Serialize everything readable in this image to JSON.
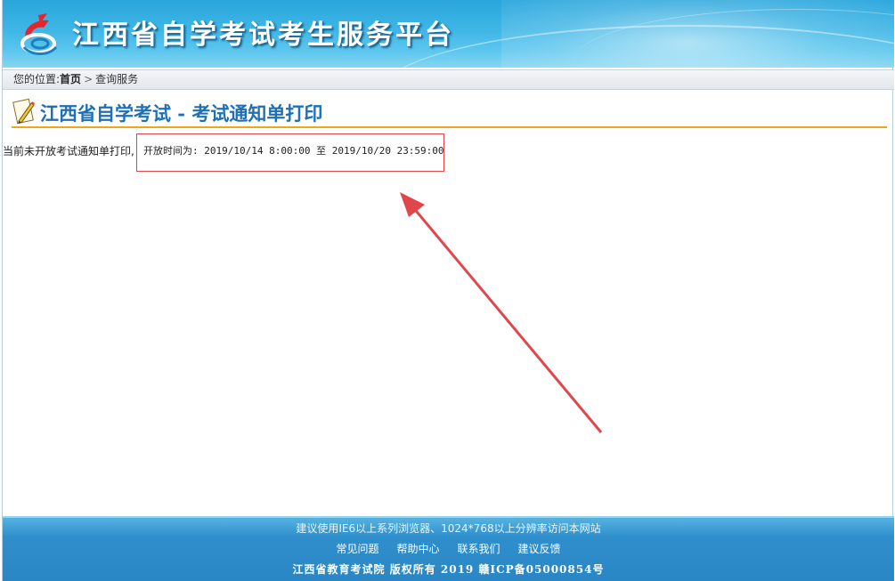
{
  "header": {
    "site_title": "江西省自学考试考生服务平台",
    "logo_icon": "red-blue-swirl-logo-icon",
    "brand_color": "#2aa6dc"
  },
  "breadcrumb": {
    "prefix": "您的位置:",
    "home": "首页",
    "separator": ">",
    "current": "查询服务"
  },
  "page": {
    "heading_icon": "pencil-icon",
    "title": "江西省自学考试 - 考试通知单打印",
    "title_color": "#1f6fb4",
    "underline_color": "#f0a51e"
  },
  "notice": {
    "message": "当前未开放考试通知单打印,",
    "open_time_label": "开放时间为:",
    "start": "2019/10/14 8:00:00",
    "to": "至",
    "end": "2019/10/20 23:59:00",
    "annotation_color": "#e0474c"
  },
  "footer": {
    "tip": "建议使用IE6以上系列浏览器、1024*768以上分辨率访问本网站",
    "links": [
      "常见问题",
      "帮助中心",
      "联系我们",
      "建议反馈"
    ],
    "copyright": "江西省教育考试院 版权所有 2019 赣ICP备05000854号"
  }
}
